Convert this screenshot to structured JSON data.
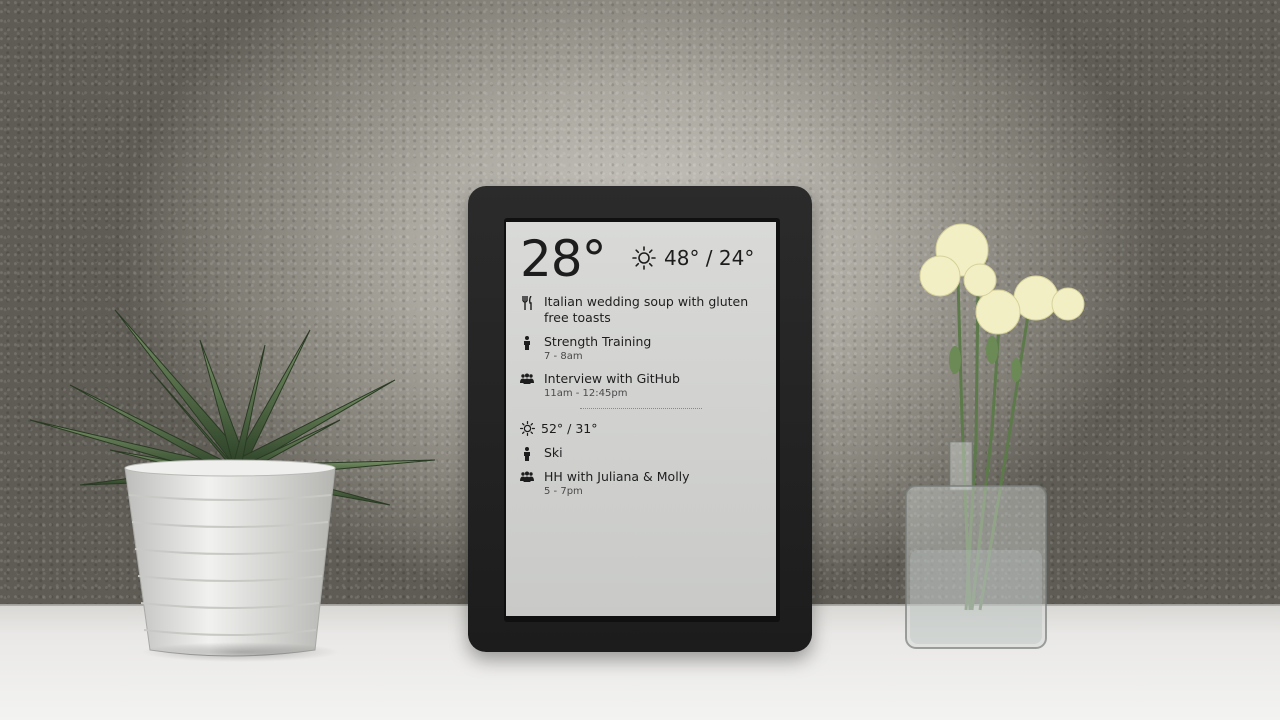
{
  "scene": {
    "objects": [
      "plant-in-white-pot",
      "e-ink-calendar-frame",
      "glass-vase-with-carnations"
    ]
  },
  "display": {
    "current_temp": "28°",
    "today_hilo": "48° / 24°",
    "today_icon": "sun-icon",
    "today_events": [
      {
        "icon": "utensils-icon",
        "title": "Italian wedding soup with gluten free toasts",
        "time": ""
      },
      {
        "icon": "person-icon",
        "title": "Strength Training",
        "time": "7 - 8am"
      },
      {
        "icon": "group-icon",
        "title": "Interview with GitHub",
        "time": "11am - 12:45pm"
      }
    ],
    "tomorrow_hilo": "52° / 31°",
    "tomorrow_icon": "sun-icon",
    "tomorrow_events": [
      {
        "icon": "person-icon",
        "title": "Ski",
        "time": ""
      },
      {
        "icon": "group-icon",
        "title": "HH with Juliana & Molly",
        "time": "5 - 7pm"
      }
    ]
  },
  "colors": {
    "frame": "#1f1f1f",
    "screen": "#d2d3d1",
    "text": "#1d1d1d",
    "pot": "#e6e6e4",
    "flowers": "#f2efc0",
    "foliage": "#3f5a3a"
  }
}
